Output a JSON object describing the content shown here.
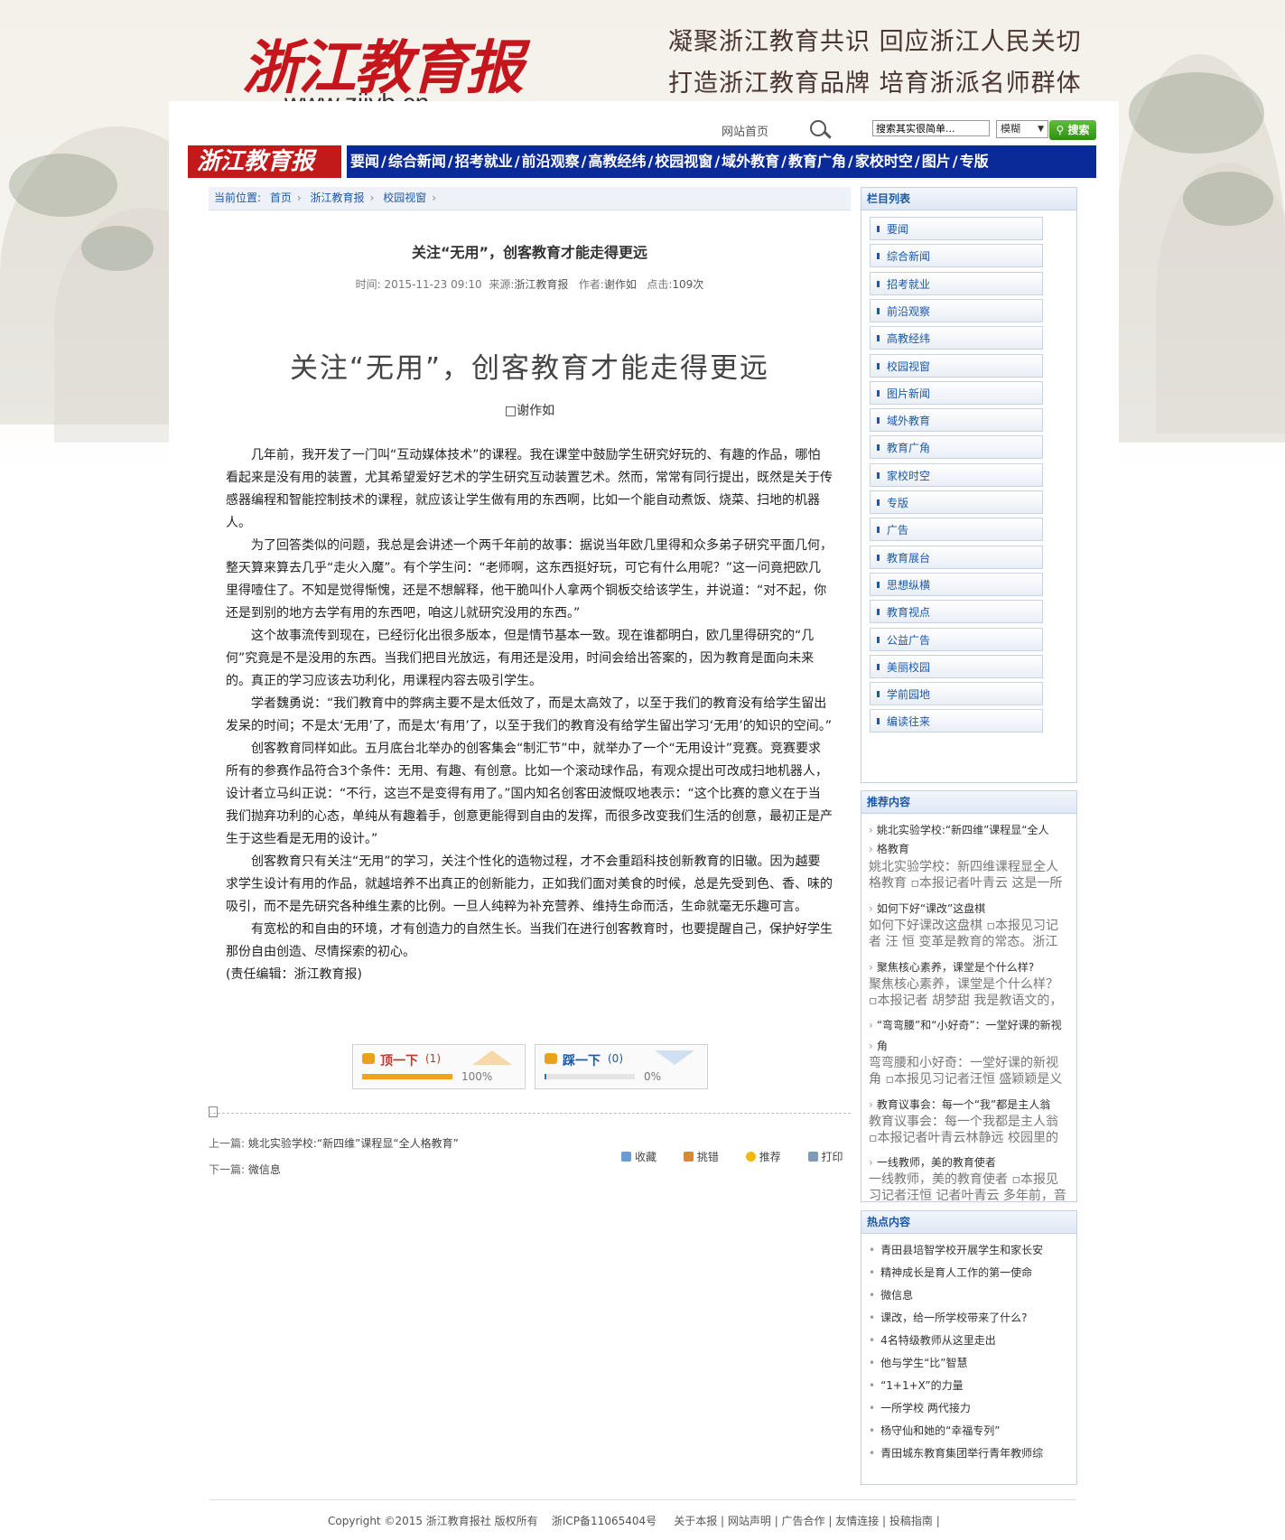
{
  "header": {
    "logo_text": "浙江教育报",
    "logo_url": "www.zjjyb.cn",
    "slogan_line1": "凝聚浙江教育共识  回应浙江人民关切",
    "slogan_line2": "打造浙江教育品牌  培育浙派名师群体"
  },
  "topbar": {
    "home_link": "网站首页",
    "search_value": "搜索其实很简单...",
    "search_mode": "模糊",
    "search_button": "搜索"
  },
  "nav": {
    "logo_text": "浙江教育报",
    "items": [
      "要闻",
      "综合新闻",
      "招考就业",
      "前沿观察",
      "高教经纬",
      "校园视窗",
      "域外教育",
      "教育广角",
      "家校时空",
      "图片",
      "专版"
    ]
  },
  "breadcrumb": {
    "label": "当前位置:",
    "items": [
      "首页",
      "浙江教育报",
      "校园视窗"
    ]
  },
  "article": {
    "title": "关注“无用”，创客教育才能走得更远",
    "meta_time_label": "时间:",
    "meta_time": "2015-11-23 09:10",
    "meta_source_label": "来源:",
    "meta_source": "浙江教育报",
    "meta_author_label": "作者:",
    "meta_author": "谢作如",
    "meta_clicks_label": "点击:",
    "meta_clicks": "109次",
    "big_title": "关注“无用”，创客教育才能走得更远",
    "byline": "□谢作如",
    "paragraphs": [
      "几年前，我开发了一门叫“互动媒体技术”的课程。我在课堂中鼓励学生研究好玩的、有趣的作品，哪怕看起来是没有用的装置，尤其希望爱好艺术的学生研究互动装置艺术。然而，常常有同行提出，既然是关于传感器编程和智能控制技术的课程，就应该让学生做有用的东西啊，比如一个能自动煮饭、烧菜、扫地的机器人。",
      "为了回答类似的问题，我总是会讲述一个两千年前的故事：据说当年欧几里得和众多弟子研究平面几何，整天算来算去几乎“走火入魔”。有个学生问：“老师啊，这东西挺好玩，可它有什么用呢？”这一问竟把欧几里得噎住了。不知是觉得惭愧，还是不想解释，他干脆叫仆人拿两个铜板交给该学生，并说道：“对不起，你还是到别的地方去学有用的东西吧，咱这儿就研究没用的东西。”",
      "这个故事流传到现在，已经衍化出很多版本，但是情节基本一致。现在谁都明白，欧几里得研究的“几何”究竟是不是没用的东西。当我们把目光放远，有用还是没用，时间会给出答案的，因为教育是面向未来的。真正的学习应该去功利化，用课程内容去吸引学生。",
      "学者魏勇说：“我们教育中的弊病主要不是太低效了，而是太高效了，以至于我们的教育没有给学生留出发呆的时间；不是太‘无用’了，而是太‘有用’了，以至于我们的教育没有给学生留出学习‘无用’的知识的空间。”",
      "创客教育同样如此。五月底台北举办的创客集会“制汇节”中，就举办了一个“无用设计”竞赛。竞赛要求所有的参赛作品符合3个条件：无用、有趣、有创意。比如一个滚动球作品，有观众提出可改成扫地机器人，设计者立马纠正说：“不行，这岂不是变得有用了。”国内知名创客田波慨叹地表示：“这个比赛的意义在于当我们抛弃功利的心态，单纯从有趣着手，创意更能得到自由的发挥，而很多改变我们生活的创意，最初正是产生于这些看是无用的设计。”",
      "创客教育只有关注“无用”的学习，关注个性化的造物过程，才不会重蹈科技创新教育的旧辙。因为越要求学生设计有用的作品，就越培养不出真正的创新能力，正如我们面对美食的时候，总是先受到色、香、味的吸引，而不是先研究各种维生素的比例。一旦人纯粹为补充营养、维持生命而活，生命就毫无乐趣可言。",
      "有宽松的和自由的环境，才有创造力的自然生长。当我们在进行创客教育时，也要提醒自己，保护好学生那份自由创造、尽情探索的初心。"
    ],
    "editor": "(责任编辑：浙江教育报)"
  },
  "votes": {
    "up_label": "顶一下",
    "up_count": "(1)",
    "up_percent": "100%",
    "up_fraction": 1.0,
    "down_label": "踩一下",
    "down_count": "(0)",
    "down_percent": "0%",
    "down_fraction": 0.0
  },
  "prevnext": {
    "prev_label": "上一篇:",
    "prev_title": "姚北实验学校:“新四维”课程显“全人格教育”",
    "next_label": "下一篇:",
    "next_title": "微信息"
  },
  "tools": [
    "收藏",
    "挑错",
    "推荐",
    "打印"
  ],
  "sidebar": {
    "categories_title": "栏目列表",
    "categories": [
      "要闻",
      "综合新闻",
      "招考就业",
      "前沿观察",
      "高教经纬",
      "校园视窗",
      "图片新闻",
      "域外教育",
      "教育广角",
      "家校时空",
      "专版",
      "广告",
      "教育展台",
      "思想纵横",
      "教育视点",
      "公益广告",
      "美丽校园",
      "学前园地",
      "编读往来"
    ],
    "recommend_title": "推荐内容",
    "recommend": [
      {
        "title": "姚北实验学校:“新四维”课程显“全人",
        "title2": "格教育",
        "desc": "姚北实验学校：新四维课程显全人格教育 ▫本报记者叶青云 这是一所"
      },
      {
        "title": "如何下好“课改”这盘棋",
        "desc": "如何下好课改这盘棋 ▫本报见习记者 汪 恒 变革是教育的常态。浙江"
      },
      {
        "title": "聚焦核心素养，课堂是个什么样?",
        "desc": "聚焦核心素养，课堂是个什么样？ ▫本报记者 胡梦甜 我是教语文的，"
      },
      {
        "title": "“弯弯腰”和“小好奇”：一堂好课的新视",
        "title2": "角",
        "desc": "弯弯腰和小好奇：一堂好课的新视角 ▫本报见习记者汪恒 盛颖颖是义"
      },
      {
        "title": "教育议事会：每一个“我”都是主人翁",
        "desc": "教育议事会：每一个我都是主人翁 ▫本报记者叶青云林静远 校园里的"
      },
      {
        "title": "一线教师，美的教育使者",
        "desc": "一线教师，美的教育使者 ▫本报见习记者汪恒 记者叶青云 多年前，音"
      }
    ],
    "hot_title": "热点内容",
    "hot": [
      "青田县培智学校开展学生和家长安",
      "精神成长是育人工作的第一使命",
      "微信息",
      "课改，给一所学校带来了什么?",
      "4名特级教师从这里走出",
      "他与学生“比”智慧",
      "“1+1+X”的力量",
      "一所学校 两代接力",
      "杨守仙和她的“幸福专列”",
      "青田城东教育集团举行青年教师综"
    ]
  },
  "footer": {
    "copyright": "Copyright ©2015 浙江教育报社 版权所有",
    "icp": "浙ICP备11065404号",
    "links": "关于本报 | 网站声明 | 广告合作 | 友情连接 | 投稿指南 |"
  },
  "colors": {
    "nav_bg": "#0b2a99",
    "logo_red": "#c4161c",
    "link_blue": "#1b58a8",
    "search_green": "#2e8f15"
  }
}
